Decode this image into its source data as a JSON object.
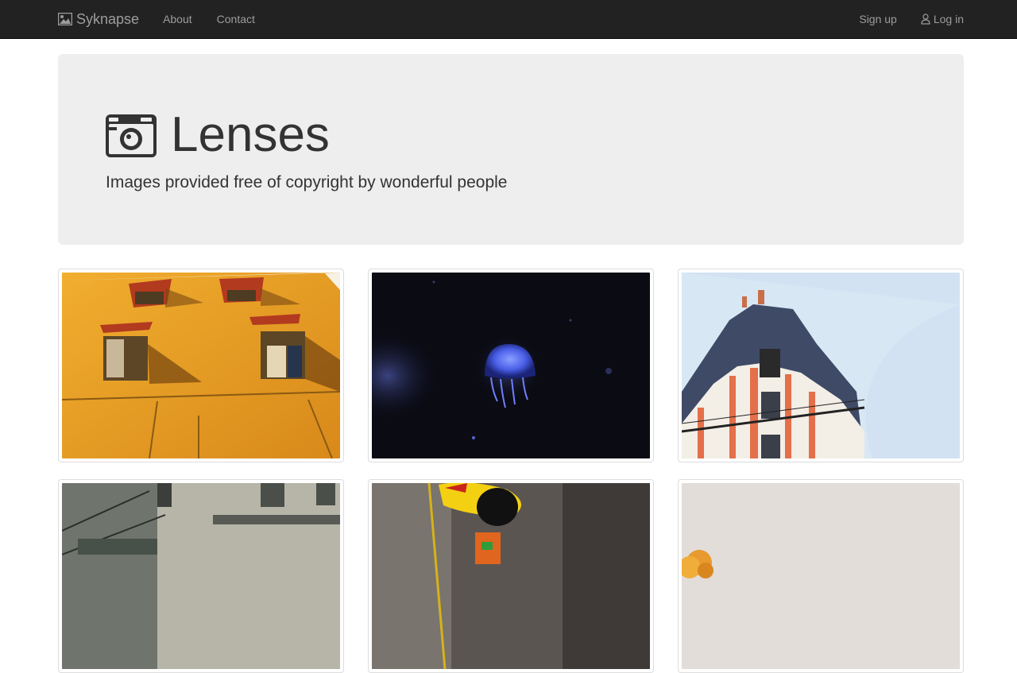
{
  "navbar": {
    "brand": "Syknapse",
    "brand_icon": "image-icon",
    "links": [
      {
        "label": "About"
      },
      {
        "label": "Contact"
      }
    ],
    "right_links": [
      {
        "label": "Sign up"
      },
      {
        "label": "Log in",
        "icon": "user-icon"
      }
    ],
    "background": "#222222",
    "link_color": "#9d9d9d"
  },
  "jumbotron": {
    "title": "Lenses",
    "title_icon": "camera-icon",
    "subtitle": "Images provided free of copyright by wonderful people",
    "background": "#eeeeee"
  },
  "gallery": {
    "images": [
      {
        "subject": "yellow-wall-windows"
      },
      {
        "subject": "jellyfish"
      },
      {
        "subject": "corner-building"
      },
      {
        "subject": "weathered-buildings"
      },
      {
        "subject": "yellow-figure"
      },
      {
        "subject": "autumn-tree"
      }
    ]
  }
}
